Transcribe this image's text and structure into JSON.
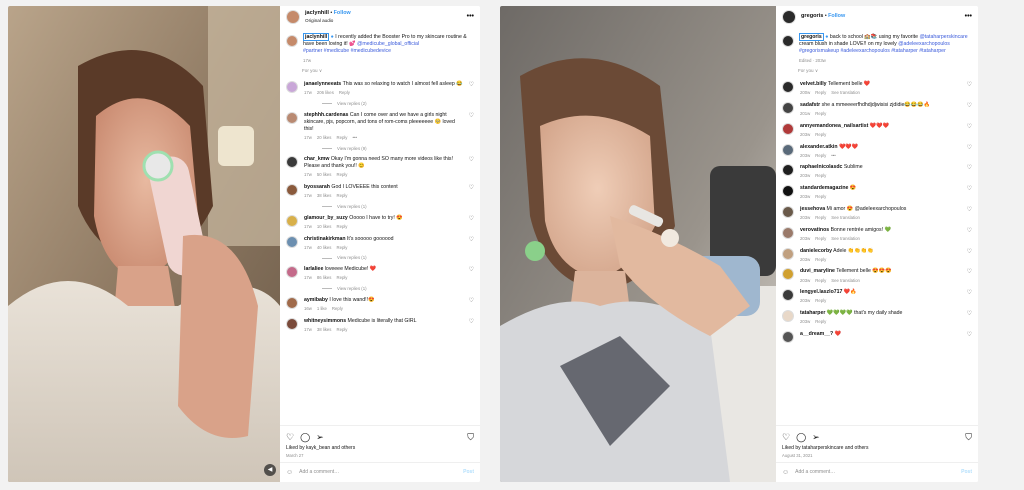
{
  "post1": {
    "header": {
      "username": "jaclynhill",
      "follow": "Follow",
      "audio": "Original audio",
      "more": "•••"
    },
    "caption": {
      "username": "jaclynhill",
      "text": "I recently added the Booster Pro to my skincare routine & have been loving it! 💕",
      "mention": "@medicube_global_official",
      "tags": "#partner #medicube #medicubedevice",
      "age": "17w"
    },
    "for_you": "For you ∨",
    "comments": [
      {
        "user": "janaelynneeats",
        "text": "This was so relaxing to watch I almost fell asleep 😂",
        "meta": [
          "17w",
          "206 likes",
          "Reply"
        ],
        "replies": "View replies (2)",
        "avatar": "#c9a7d8"
      },
      {
        "user": "stephhh.cardenas",
        "text": "Can I come over and we have a girls night skincare, pjs, popcorn, and tons of rom-coms pleeeeeee 🥺 loved this!",
        "meta": [
          "17w",
          "20 likes",
          "Reply",
          "•••"
        ],
        "replies": "View replies (9)",
        "avatar": "#b98a72"
      },
      {
        "user": "char_kmw",
        "text": "Okay I'm gonna need SO many more videos like this! Please and thank you!! 😊",
        "meta": [
          "17w",
          "50 likes",
          "Reply"
        ],
        "replies": "",
        "avatar": "#3a3a3a"
      },
      {
        "user": "byossarah",
        "text": "God I LOVEEEE this content",
        "meta": [
          "17w",
          "38 likes",
          "Reply"
        ],
        "replies": "View replies (1)",
        "avatar": "#8a5a3c"
      },
      {
        "user": "glamour_by_suzy",
        "text": "Ooooo I have to try! 😍",
        "meta": [
          "17w",
          "10 likes",
          "Reply"
        ],
        "replies": "",
        "avatar": "#d8b04a"
      },
      {
        "user": "christinakirkman",
        "text": "It's sooooo goooood",
        "meta": [
          "17w",
          "40 likes",
          "Reply"
        ],
        "replies": "View replies (1)",
        "avatar": "#6c8fb0"
      },
      {
        "user": "larlaliee",
        "text": "loveeee Medicube! ❤️",
        "meta": [
          "17w",
          "86 likes",
          "Reply"
        ],
        "replies": "View replies (1)",
        "avatar": "#c46a8a"
      },
      {
        "user": "aymibaby",
        "text": "I love this wand!!😍",
        "meta": [
          "16w",
          "1 like",
          "Reply"
        ],
        "replies": "",
        "avatar": "#a06a4a"
      },
      {
        "user": "whitneysimmons",
        "text": "Medicube is literally that GIRL",
        "meta": [
          "17w",
          "38 likes",
          "Reply"
        ],
        "replies": "",
        "avatar": "#7a4a3a"
      }
    ],
    "liked_by": "Liked by kayk_bean and others",
    "date": "March 27",
    "add_comment": "Add a comment…",
    "post": "Post"
  },
  "post2": {
    "header": {
      "username": "gregoris",
      "follow": "Follow",
      "more": "•••"
    },
    "caption": {
      "username": "gregoris",
      "text": "back to school 🏫📚 using my favorite",
      "mention1": "@tataharperskincare",
      "text2": "cream blush in shade LOVE!! on my lovely",
      "mention2": "@adeleexarchopoulos",
      "tags": "#gregorismakeup #adeleexarchopoulos #tataharper #tataharper",
      "meta": "Edited · 203w"
    },
    "for_you": "For you ∨",
    "comments": [
      {
        "user": "velvet.billy",
        "text": "Tellement belle ❤️",
        "meta": [
          "200w",
          "Reply",
          "See translation"
        ],
        "avatar": "#2a2a2a"
      },
      {
        "user": "sadafstr",
        "text": "she a mmeeeerfhdhdjdjwisisi zjdidie😂😂😂🔥",
        "meta": [
          "201w",
          "Reply"
        ],
        "avatar": "#444444"
      },
      {
        "user": "annyemandonea_nailsartist",
        "text": "❤️❤️❤️",
        "meta": [
          "203w",
          "Reply"
        ],
        "avatar": "#b03a3a"
      },
      {
        "user": "alexander.atkin",
        "text": "❤️❤️❤️",
        "meta": [
          "203w",
          "Reply",
          "•••"
        ],
        "avatar": "#5a6a7a"
      },
      {
        "user": "raphaelnicolasdc",
        "text": "Sublime",
        "meta": [
          "203w",
          "Reply"
        ],
        "avatar": "#1f1f1f"
      },
      {
        "user": "standardemagazine",
        "text": "😍",
        "meta": [
          "203w",
          "Reply"
        ],
        "avatar": "#111111"
      },
      {
        "user": "jessehova",
        "text": "Mi amor 😍 @adeleexarchopoulos",
        "meta": [
          "203w",
          "Reply",
          "See translation"
        ],
        "avatar": "#6a5a4a"
      },
      {
        "user": "verovatinos",
        "text": "Bonne rentrée amigos! 💚",
        "meta": [
          "203w",
          "Reply",
          "See translation"
        ],
        "avatar": "#9a7a6a"
      },
      {
        "user": "danielecorby",
        "text": "Adele 👏👏👏👏",
        "meta": [
          "203w",
          "Reply"
        ],
        "avatar": "#c0a080"
      },
      {
        "user": "duvi_maryline",
        "text": "Tellement belle 😍😍😍",
        "meta": [
          "203w",
          "Reply",
          "See translation"
        ],
        "avatar": "#d0a030"
      },
      {
        "user": "lengyel.laszlo717",
        "text": "❤️🔥",
        "meta": [
          "203w",
          "Reply"
        ],
        "avatar": "#3a3a3a"
      },
      {
        "user": "tataharper",
        "text": "💚💚💚💚 that's my daily shade",
        "meta": [
          "203w",
          "Reply"
        ],
        "avatar": "#e8d8c8"
      },
      {
        "user": "a__dream__?",
        "text": "❤️",
        "meta": [],
        "avatar": "#555555"
      }
    ],
    "liked_by": "Liked by tataharperskincare and others",
    "date": "August 31, 2021",
    "add_comment": "Add a comment…",
    "post": "Post"
  }
}
